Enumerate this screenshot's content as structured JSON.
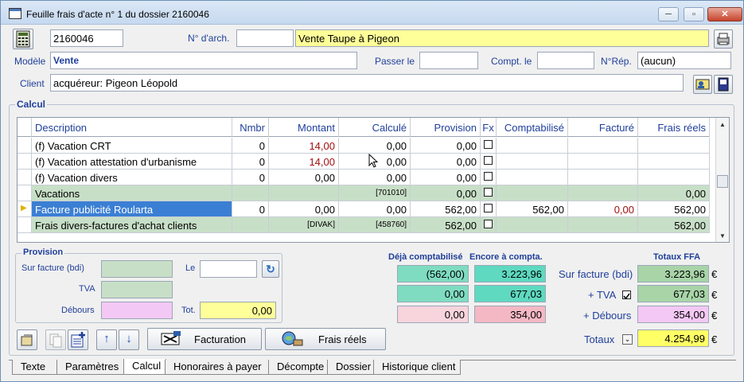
{
  "window": {
    "title": "Feuille frais d'acte n° 1 du dossier 2160046",
    "min": "─",
    "max": "▫",
    "close": "✕"
  },
  "header": {
    "dossier": "2160046",
    "num_arch_label": "N° d'arch.",
    "num_arch_value": "",
    "titre": "Vente Taupe à Pigeon",
    "modele_label": "Modèle",
    "modele_value": "Vente",
    "passer_label": "Passer le",
    "passer_value": "",
    "compt_label": "Compt. le",
    "compt_value": "",
    "nrep_label": "N°Rép.",
    "nrep_value": "(aucun)",
    "client_label": "Client",
    "client_value": "acquéreur: Pigeon Léopold"
  },
  "calcul": {
    "title": "Calcul",
    "columns": [
      "Description",
      "Nmbr",
      "Montant",
      "Calculé",
      "Provision",
      "Fx",
      "Comptabilisé",
      "Facturé",
      "Frais réels"
    ],
    "rows": [
      {
        "desc": "(f) Vacation CRT",
        "nmbr": "0",
        "montant": "14,00",
        "calcule": "0,00",
        "provision": "0,00",
        "compta": "",
        "facture": "",
        "frais": ""
      },
      {
        "desc": "(f) Vacation attestation d'urbanisme",
        "nmbr": "0",
        "montant": "14,00",
        "calcule": "0,00",
        "provision": "0,00",
        "compta": "",
        "facture": "",
        "frais": ""
      },
      {
        "desc": "(f) Vacation divers",
        "nmbr": "0",
        "montant": "0,00",
        "calcule": "0,00",
        "provision": "0,00",
        "compta": "",
        "facture": "",
        "frais": ""
      },
      {
        "desc": "Vacations",
        "nmbr": "",
        "montant": "",
        "calcule": "[701010]",
        "provision": "0,00",
        "compta": "",
        "facture": "",
        "frais": "0,00"
      },
      {
        "desc": "Facture publicité Roularta",
        "nmbr": "0",
        "montant": "0,00",
        "calcule": "0,00",
        "provision": "562,00",
        "compta": "562,00",
        "facture": "0,00",
        "frais": "562,00"
      },
      {
        "desc": "Frais divers-factures d'achat clients",
        "nmbr": "",
        "montant": "[DIVAK]",
        "calcule": "[458760]",
        "provision": "562,00",
        "compta": "",
        "facture": "",
        "frais": "562,00"
      }
    ]
  },
  "provision": {
    "title": "Provision",
    "sur_facture_label": "Sur facture (bdi)",
    "tva_label": "TVA",
    "debours_label": "Débours",
    "le_label": "Le",
    "tot_label": "Tot.",
    "tot_value": "0,00"
  },
  "totaux": {
    "deja_label": "Déjà comptabilisé",
    "encore_label": "Encore à compta.",
    "ffa_label": "Totaux FFA",
    "deja": [
      "(562,00)",
      "0,00",
      "0,00"
    ],
    "encore": [
      "3.223,96",
      "677,03",
      "354,00"
    ],
    "sur_facture_label": "Sur facture (bdi)",
    "tva_label": "+ TVA",
    "debours_label": "+ Débours",
    "totaux_label": "Totaux",
    "ffa": [
      "3.223,96",
      "677,03",
      "354,00",
      "4.254,99"
    ],
    "euro": "€"
  },
  "buttons": {
    "facturation": "Facturation",
    "frais_reels": "Frais réels"
  },
  "tabs": [
    "Texte",
    "Paramètres",
    "Calcul",
    "Honoraires à payer",
    "Décompte",
    "Dossier",
    "Historique client"
  ],
  "colors": {
    "yellow": "#ffff99",
    "green": "#c8dfc7",
    "teal": "#7fdcc0",
    "pink": "#f8d4dc",
    "violet": "#f4c8f4",
    "selected": "#3b7fd4"
  }
}
